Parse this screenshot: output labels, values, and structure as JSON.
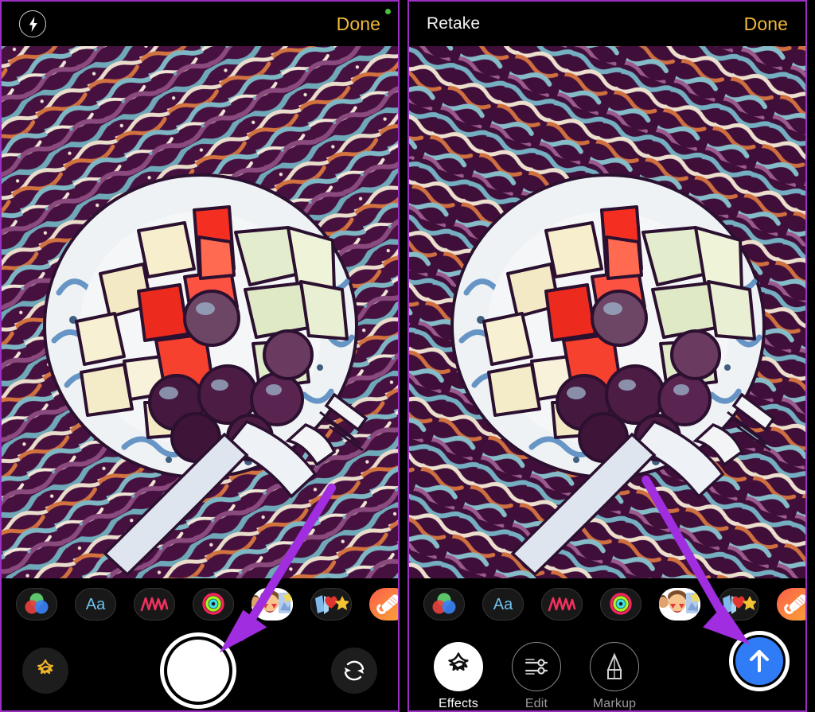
{
  "theme": {
    "accent_done": "#f2b937",
    "annotation_arrow": "#a02ee0",
    "panel_border": "#9b2fc4",
    "send_blue": "#2f7cf6",
    "rec_dot_green": "#4fbd3e",
    "background": "#000000"
  },
  "panels": [
    {
      "id": "camera-capture",
      "topbar": {
        "flash_icon": "flash-bolt-icon",
        "left_label": "",
        "done_label": "Done",
        "rec_indicator": "green-dot-indicator"
      },
      "photo": {
        "alt": "Comic-filtered photo of a fruit plate with watermelon, melon cubes and blueberries, fork and knife on a patterned tablecloth"
      },
      "effects": [
        {
          "name": "filters-icon",
          "label": "Filters"
        },
        {
          "name": "text-aa-icon",
          "label": "Aa"
        },
        {
          "name": "shapes-icon",
          "label": "Shapes"
        },
        {
          "name": "activity-rings-icon",
          "label": "Activity"
        },
        {
          "name": "memoji-icon",
          "label": "Memoji"
        },
        {
          "name": "stickers-icon",
          "label": "Stickers"
        },
        {
          "name": "music-icon",
          "label": "Music"
        }
      ],
      "controls": {
        "effects_star_icon": "effects-star-icon",
        "shutter_label": "Shutter",
        "flip_camera_icon": "flip-camera-icon"
      },
      "annotation": {
        "arrow": "arrow-pointing-to-shutter-button",
        "target": "shutter-button"
      }
    },
    {
      "id": "photo-review",
      "topbar": {
        "flash_icon": "",
        "left_label": "Retake",
        "done_label": "Done",
        "rec_indicator": ""
      },
      "photo": {
        "alt": "Comic-filtered photo of a fruit plate with watermelon, melon cubes and blueberries, fork and knife on a patterned tablecloth"
      },
      "effects": [
        {
          "name": "filters-icon",
          "label": "Filters"
        },
        {
          "name": "text-aa-icon",
          "label": "Aa"
        },
        {
          "name": "shapes-icon",
          "label": "Shapes"
        },
        {
          "name": "activity-rings-icon",
          "label": "Activity"
        },
        {
          "name": "memoji-icon",
          "label": "Memoji"
        },
        {
          "name": "stickers-icon",
          "label": "Stickers"
        },
        {
          "name": "music-icon",
          "label": "Music"
        }
      ],
      "actions": [
        {
          "name": "effects-button",
          "icon": "effects-star-icon",
          "label": "Effects",
          "active": true
        },
        {
          "name": "edit-button",
          "icon": "sliders-icon",
          "label": "Edit",
          "active": false
        },
        {
          "name": "markup-button",
          "icon": "marker-pen-icon",
          "label": "Markup",
          "active": false
        }
      ],
      "send": {
        "name": "send-button",
        "icon": "arrow-up-icon",
        "label": "Send"
      },
      "annotation": {
        "arrow": "arrow-pointing-to-send-button",
        "target": "send-button"
      }
    }
  ]
}
